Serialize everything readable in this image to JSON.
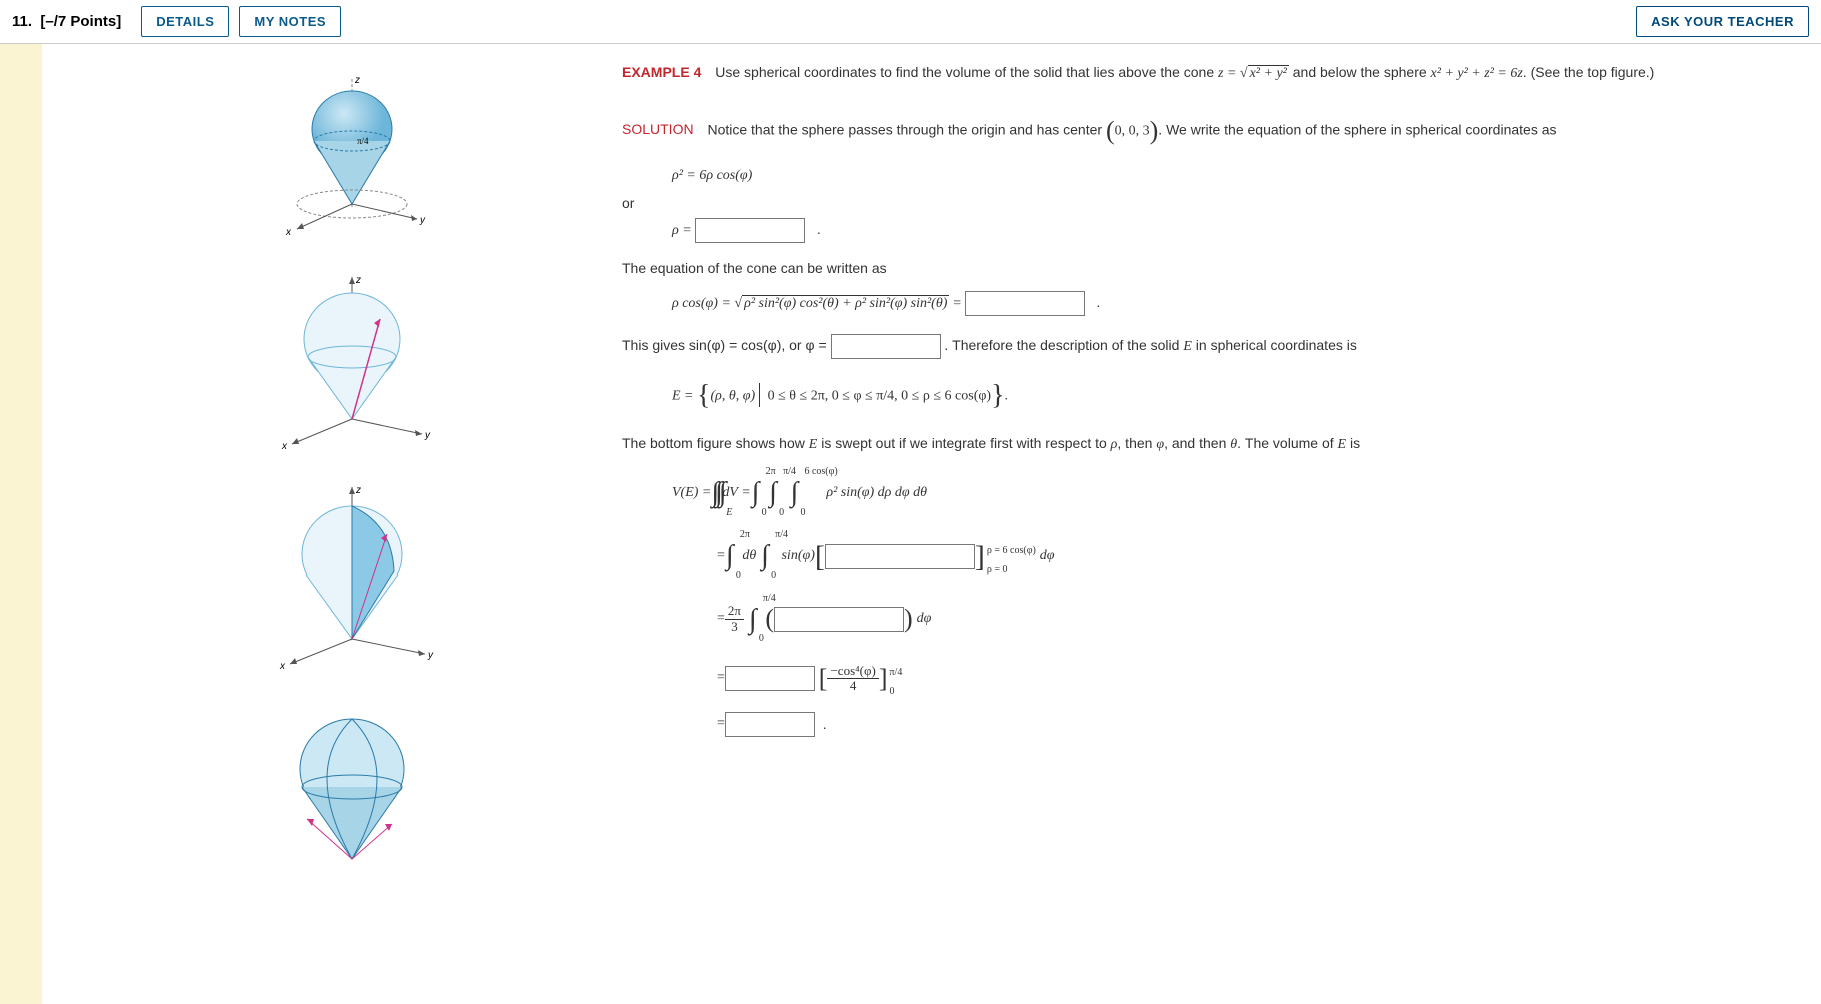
{
  "header": {
    "question_label": "11.",
    "points_label": "[–/7 Points]",
    "details_btn": "DETAILS",
    "notes_btn": "MY NOTES",
    "ask_btn": "ASK YOUR TEACHER"
  },
  "content": {
    "example_label": "EXAMPLE 4",
    "example_text_1": "Use spherical coordinates to find the volume of the solid that lies above the cone ",
    "eq_cone_lhs": "z = ",
    "eq_cone_rhs_under": "x² + y²",
    "example_text_2": " and below the sphere ",
    "eq_sphere": "x² + y² + z² = 6z",
    "example_text_3": ". (See the top figure.)",
    "solution_label": "SOLUTION",
    "sol_text_1": "Notice that the sphere passes through the origin and has center ",
    "center_pt": "0, 0, 3",
    "sol_text_2": ". We write the equation of the sphere in spherical coordinates as",
    "eq_rho_sq": "ρ² = 6ρ cos(φ)",
    "or_lbl": "or",
    "rho_eq_lbl": "ρ = ",
    "period": ".",
    "cone_text": "The equation of the cone can be written as",
    "cone_eq_lhs": "ρ cos(φ) = ",
    "cone_eq_under": "ρ² sin²(φ) cos²(θ) + ρ² sin²(φ) sin²(θ)",
    "equals_sp": " = ",
    "gives_text_1": "This gives sin(φ) = cos(φ), or φ = ",
    "gives_text_2": ". Therefore the description of the solid ",
    "E_var": "E",
    "gives_text_3": " in spherical coordinates is",
    "set_lhs": "E = ",
    "set_tuple": "(ρ, θ, φ)",
    "set_cond": " 0 ≤ θ ≤ 2π, 0 ≤ φ ≤ π/4, 0 ≤ ρ ≤ 6 cos(φ)",
    "bottom_text": "The bottom figure shows how ",
    "bottom_text_2": " is swept out if we integrate first with respect to ",
    "rho_var": "ρ",
    "then_lbl": ", then ",
    "phi_var": "φ",
    "and_then": ", and then ",
    "theta_var": "θ",
    "vol_text": ". The volume of ",
    "is_lbl": " is",
    "V_lhs": "V(E) = ",
    "dV": " dV = ",
    "int1_ub": "2π",
    "int1_lb": "0",
    "int2_ub": "π/4",
    "int2_lb": "0",
    "int3_ub": "6 cos(φ)",
    "int3_lb": "0",
    "integrand1": "ρ² sin(φ) dρ dφ dθ",
    "line2_pre": " = ",
    "line2_dtheta": " dθ",
    "line2_sinphi": " sin(φ)",
    "brk_ub": "ρ = 6 cos(φ)",
    "brk_lb": "ρ = 0",
    "line2_dphi": " dφ",
    "line3_pre": " = ",
    "frac_2pi": "2π",
    "frac_3": "3",
    "line3_dphi": " dφ",
    "line4_pre": " = ",
    "cos4_num": "−cos⁴(φ)",
    "cos4_den": "4",
    "brk2_ub": "π/4",
    "brk2_lb": "0",
    "line5_pre": " = "
  }
}
